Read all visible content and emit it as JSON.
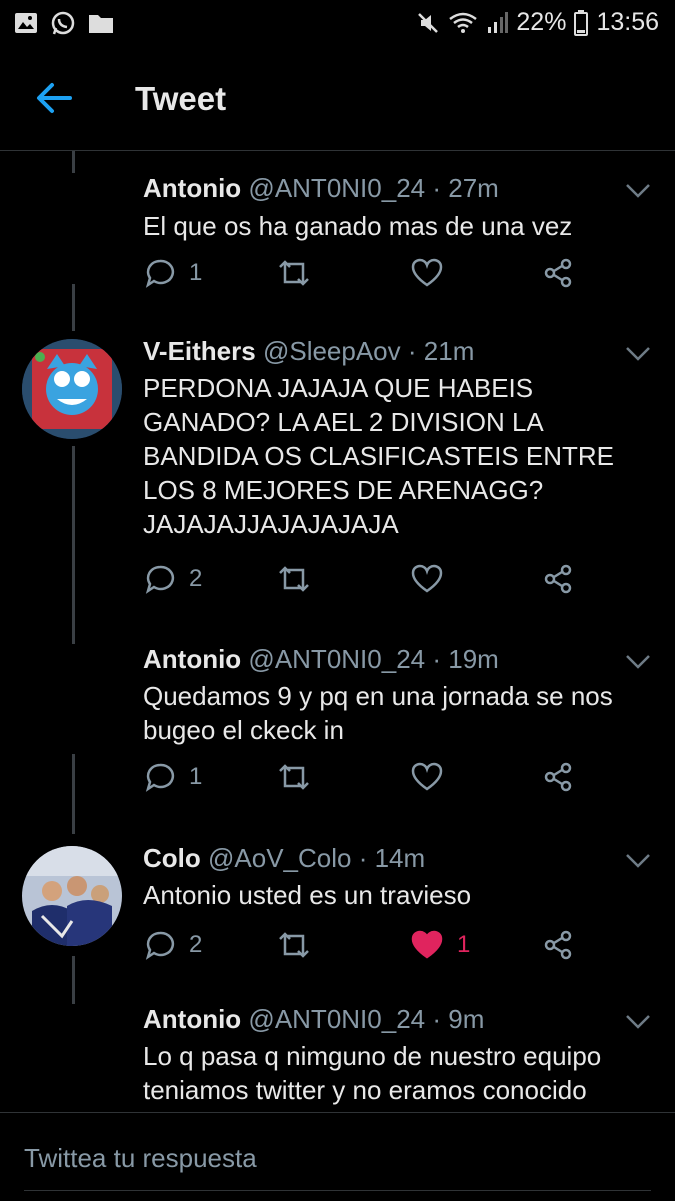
{
  "status_bar": {
    "battery": "22%",
    "time": "13:56",
    "icons_left": [
      "gallery-icon",
      "whatsapp-icon",
      "folder-icon"
    ],
    "icons_right": [
      "mute-icon",
      "wifi-icon",
      "signal-icon",
      "battery-icon"
    ]
  },
  "header": {
    "title": "Tweet"
  },
  "tweets": [
    {
      "name": "Antonio",
      "handle": "@ANT0NI0_24",
      "time": "· 27m",
      "text": "El que os ha ganado mas de una vez",
      "replies": "1",
      "retweets": "",
      "likes": "",
      "liked": false
    },
    {
      "name": "V-Eithers",
      "handle": "@SleepAov",
      "time": "· 21m",
      "text": "PERDONA JAJAJA QUE HABEIS GANADO? LA AEL 2 DIVISION LA BANDIDA OS CLASIFICASTEIS ENTRE LOS 8 MEJORES DE ARENAGG? JAJAJAJJAJAJAJAJA",
      "replies": "2",
      "retweets": "",
      "likes": "",
      "liked": false
    },
    {
      "name": "Antonio",
      "handle": "@ANT0NI0_24",
      "time": "· 19m",
      "text": "Quedamos 9 y pq en una jornada se nos bugeo el ckeck in",
      "replies": "1",
      "retweets": "",
      "likes": "",
      "liked": false
    },
    {
      "name": "Colo",
      "handle": "@AoV_Colo",
      "time": "· 14m",
      "text": "Antonio usted es un travieso",
      "replies": "2",
      "retweets": "",
      "likes": "1",
      "liked": true
    },
    {
      "name": "Antonio",
      "handle": "@ANT0NI0_24",
      "time": "· 9m",
      "text": "Lo q pasa q nimguno de nuestro equipo teniamos twitter y no eramos conocido",
      "replies": "",
      "retweets": "",
      "likes": "",
      "liked": false
    }
  ],
  "reply_bar": {
    "placeholder": "Twittea tu respuesta"
  },
  "colors": {
    "accent": "#1da1f2",
    "like": "#e0245e",
    "muted": "#8899a6",
    "divider": "#2f3336"
  }
}
